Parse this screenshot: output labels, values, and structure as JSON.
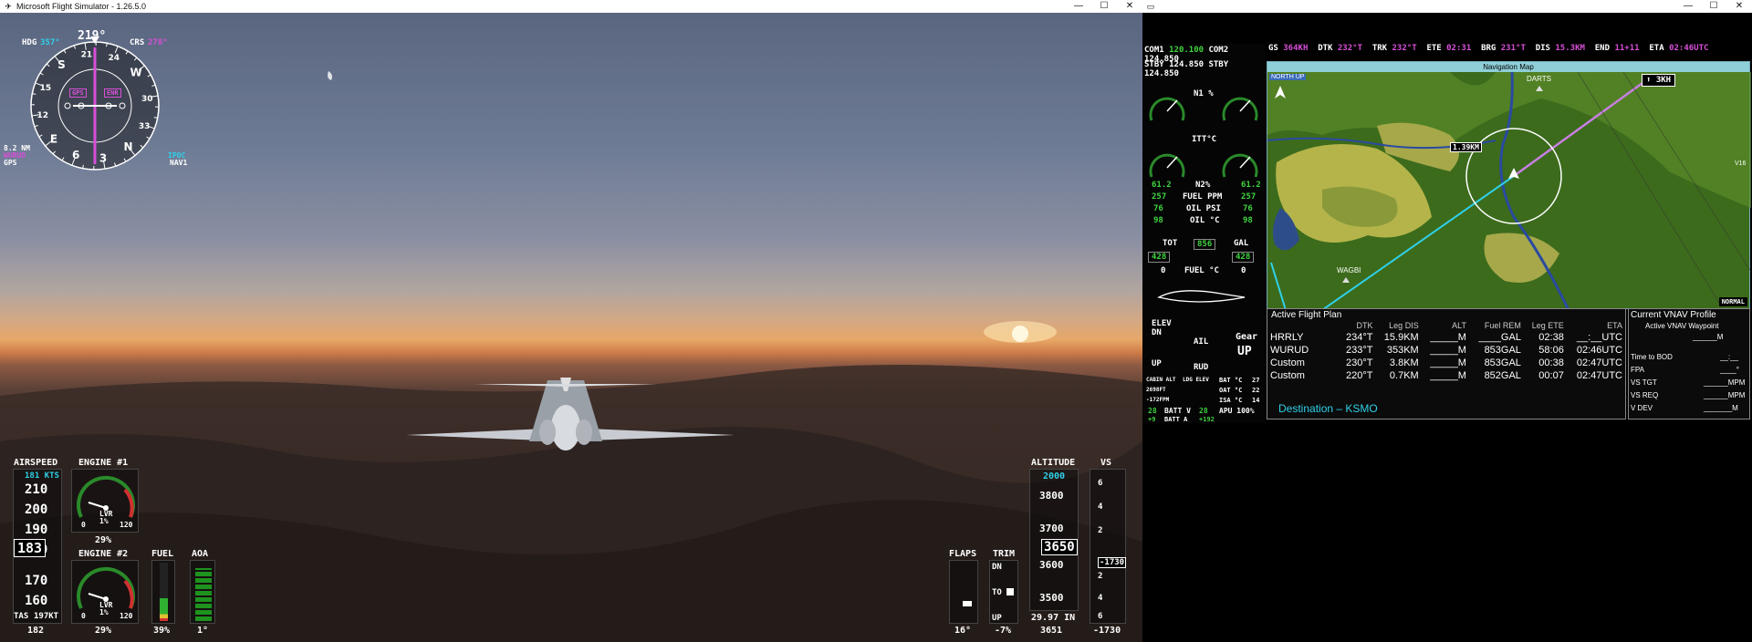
{
  "win1": {
    "title": "Microsoft Flight Simulator - 1.26.5.0",
    "min": "—",
    "max": "☐",
    "close": "✕"
  },
  "win2": {
    "min": "—",
    "max": "☐",
    "close": "✕"
  },
  "hsi": {
    "heading": "219°",
    "hdg_label": "HDG",
    "hdg_value": "357°",
    "crs_label": "CRS",
    "crs_value": "278°",
    "gps_badge": "GPS",
    "enr_badge": "ENR",
    "dist": "8.2 NM",
    "wpt": "WURUD",
    "src": "GPS",
    "ipoc": "IPOC",
    "nav1": "NAV1",
    "card": [
      "N",
      "3",
      "6",
      "E",
      "12",
      "15",
      "S",
      "21",
      "24",
      "W",
      "30",
      "33"
    ]
  },
  "airspeed": {
    "label": "AIRSPEED",
    "bug": "181 KTS",
    "ticks": [
      "210",
      "200",
      "190",
      "180",
      "170",
      "160"
    ],
    "current": "183",
    "tas_label": "TAS",
    "tas": "197KT",
    "bottom": "182"
  },
  "engine1": {
    "label": "ENGINE #1",
    "lvr": "LVR",
    "pct": "1%",
    "zero": "0",
    "max": "120",
    "readout": "29%"
  },
  "engine2": {
    "label": "ENGINE #2",
    "lvr": "LVR",
    "pct": "1%",
    "zero": "0",
    "max": "120",
    "readout": "29%"
  },
  "fuel": {
    "label": "FUEL",
    "readout": "39%",
    "level": 0.39
  },
  "aoa": {
    "label": "AOA",
    "readout": "1°"
  },
  "flaps": {
    "label": "FLAPS",
    "readout": "16°"
  },
  "trim": {
    "label": "TRIM",
    "dn": "DN",
    "to": "TO",
    "up": "UP",
    "readout": "-7%"
  },
  "altitude": {
    "label": "ALTITUDE",
    "bug": "2000",
    "ticks": [
      "3800",
      "3700",
      "3600",
      "3500"
    ],
    "current": "3650",
    "baro": "29.97 IN",
    "bottom": "3651"
  },
  "vs": {
    "label": "VS",
    "ticks": [
      "6",
      "4",
      "2",
      "2",
      "4",
      "6"
    ],
    "current": "-1730",
    "bottom": "-1730"
  },
  "g2": {
    "com1_label": "COM1",
    "com1": "120.100",
    "com2_label": "COM2",
    "com2": "124.850",
    "stby1_label": "STBY",
    "stby1": "124.850",
    "stby2_label": "STBY",
    "stby2": "124.850",
    "n1_label": "N1 %",
    "itt_label": "ITT°C",
    "n2_label": "N2%",
    "ff_label": "FUEL PPM",
    "oilp_label": "OIL PSI",
    "oilt_label": "OIL °C",
    "n2_l": "61.2",
    "n2_r": "61.2",
    "ff_l": "257",
    "ff_r": "257",
    "oilp_l": "76",
    "oilp_r": "76",
    "oilt_l": "98",
    "oilt_r": "98",
    "tot_label": "TOT",
    "gal_label": "GAL",
    "tot_val": "856",
    "left_q": "428",
    "right_q": "428",
    "fuel_c_label": "FUEL °C",
    "fuel_c_l": "0",
    "fuel_c_r": "0",
    "elev": "ELEV",
    "dn": "DN",
    "up": "UP",
    "ail": "AIL",
    "rud": "RUD",
    "gear_label": "Gear",
    "gear": "UP",
    "cabin_alt": "CABIN ALT",
    "ldg_elev": "LDG ELEV",
    "cab_val": "2698FT",
    "cab_rate": "-172FPM",
    "bat_c_l": "BAT °C",
    "bat_c": "27",
    "oat_l": "OAT °C",
    "oat": "22",
    "isa_l": "ISA °C",
    "isa": "14",
    "batt_v_label": "BATT V",
    "batt_v_l": "28",
    "batt_v_r": "28",
    "batt_a_label": "BATT A",
    "batt_a_l": "+9",
    "batt_a_r": "+192",
    "apu": "APU 100%"
  },
  "navbar": {
    "gs_l": "GS",
    "gs": "364KH",
    "dtk_l": "DTK",
    "dtk": "232°T",
    "trk_l": "TRK",
    "trk": "232°T",
    "ete_l": "ETE",
    "ete": "02:31",
    "brg_l": "BRG",
    "brg": "231°T",
    "dis_l": "DIS",
    "dis": "15.3KM",
    "end_l": "END",
    "end": "11+11",
    "eta_l": "ETA",
    "eta": "02:46UTC"
  },
  "map": {
    "title": "Navigation Map",
    "north": "NORTH UP",
    "range": "3KH",
    "dist": "1.39KM",
    "darts": "DARTS",
    "wagbi": "WAGBI",
    "v16": "V16",
    "mode": "NORMAL"
  },
  "flightplan": {
    "title": "Active Flight Plan",
    "cols": [
      "",
      "DTK",
      "Leg DIS",
      "ALT",
      "Fuel REM",
      "Leg ETE",
      "ETA"
    ],
    "rows": [
      {
        "name": "HRRLY",
        "dtk": "234°T",
        "dis": "15.9KM",
        "alt": "_____M",
        "rem": "____GAL",
        "ete": "02:38",
        "eta": "__:__UTC"
      },
      {
        "name": "WURUD",
        "dtk": "233°T",
        "dis": "353KM",
        "alt": "_____M",
        "rem": "853GAL",
        "ete": "58:06",
        "eta": "02:46UTC"
      },
      {
        "name": "Custom",
        "dtk": "230°T",
        "dis": "3.8KM",
        "alt": "_____M",
        "rem": "853GAL",
        "ete": "00:38",
        "eta": "02:47UTC"
      },
      {
        "name": "Custom",
        "dtk": "220°T",
        "dis": "0.7KM",
        "alt": "_____M",
        "rem": "852GAL",
        "ete": "00:07",
        "eta": "02:47UTC"
      }
    ],
    "dest": "Destination – KSMO"
  },
  "vnav": {
    "title": "Current VNAV Profile",
    "sub": "Active VNAV Waypoint",
    "wpt_val": "______M",
    "tod": "Time to BOD",
    "tod_v": "__:__",
    "fpa": "FPA",
    "fpa_v": "____°",
    "vstgt": "VS TGT",
    "vstgt_v": "______MPM",
    "vsreq": "VS REQ",
    "vsreq_v": "______MPM",
    "vdev": "V DEV",
    "vdev_v": "_______M"
  }
}
